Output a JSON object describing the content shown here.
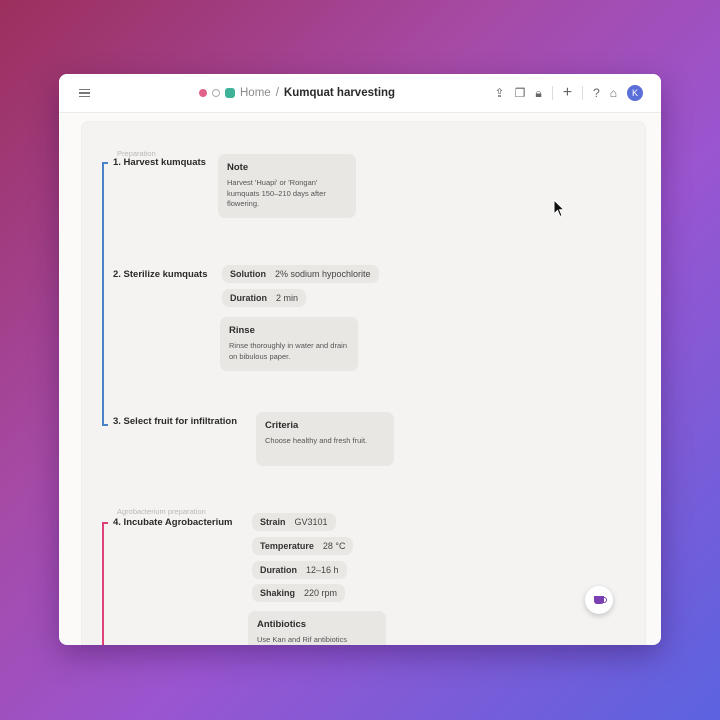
{
  "app": {
    "breadcrumb_home": "Home",
    "breadcrumb_sep": "/",
    "page_title": "Kumquat harvesting",
    "avatar_initial": "K",
    "help_label": "?"
  },
  "sections": [
    {
      "label": "Preparation",
      "color": "#4a82c8"
    },
    {
      "label": "Agrobacterium preparation",
      "color": "#e0407a"
    }
  ],
  "steps": [
    {
      "title": "1. Harvest kumquats"
    },
    {
      "title": "2. Sterilize kumquats"
    },
    {
      "title": "3. Select fruit for infiltration"
    },
    {
      "title": "4. Incubate Agrobacterium"
    }
  ],
  "cards": {
    "note": {
      "title": "Note",
      "body": "Harvest 'Huapi' or 'Rongan' kumquats 150–210 days after flowering."
    },
    "rinse": {
      "title": "Rinse",
      "body": "Rinse thoroughly in water and drain on bibulous paper."
    },
    "criteria": {
      "title": "Criteria",
      "body": "Choose healthy and fresh fruit."
    },
    "antibiotics": {
      "title": "Antibiotics",
      "body": "Use Kan and Rif antibiotics"
    }
  },
  "chips": {
    "sterilize": [
      {
        "key": "Solution",
        "value": "2% sodium hypochlorite"
      },
      {
        "key": "Duration",
        "value": "2 min"
      }
    ],
    "incubate": [
      {
        "key": "Strain",
        "value": "GV3101"
      },
      {
        "key": "Temperature",
        "value": "28 °C"
      },
      {
        "key": "Duration",
        "value": "12–16 h"
      },
      {
        "key": "Shaking",
        "value": "220 rpm"
      }
    ]
  }
}
